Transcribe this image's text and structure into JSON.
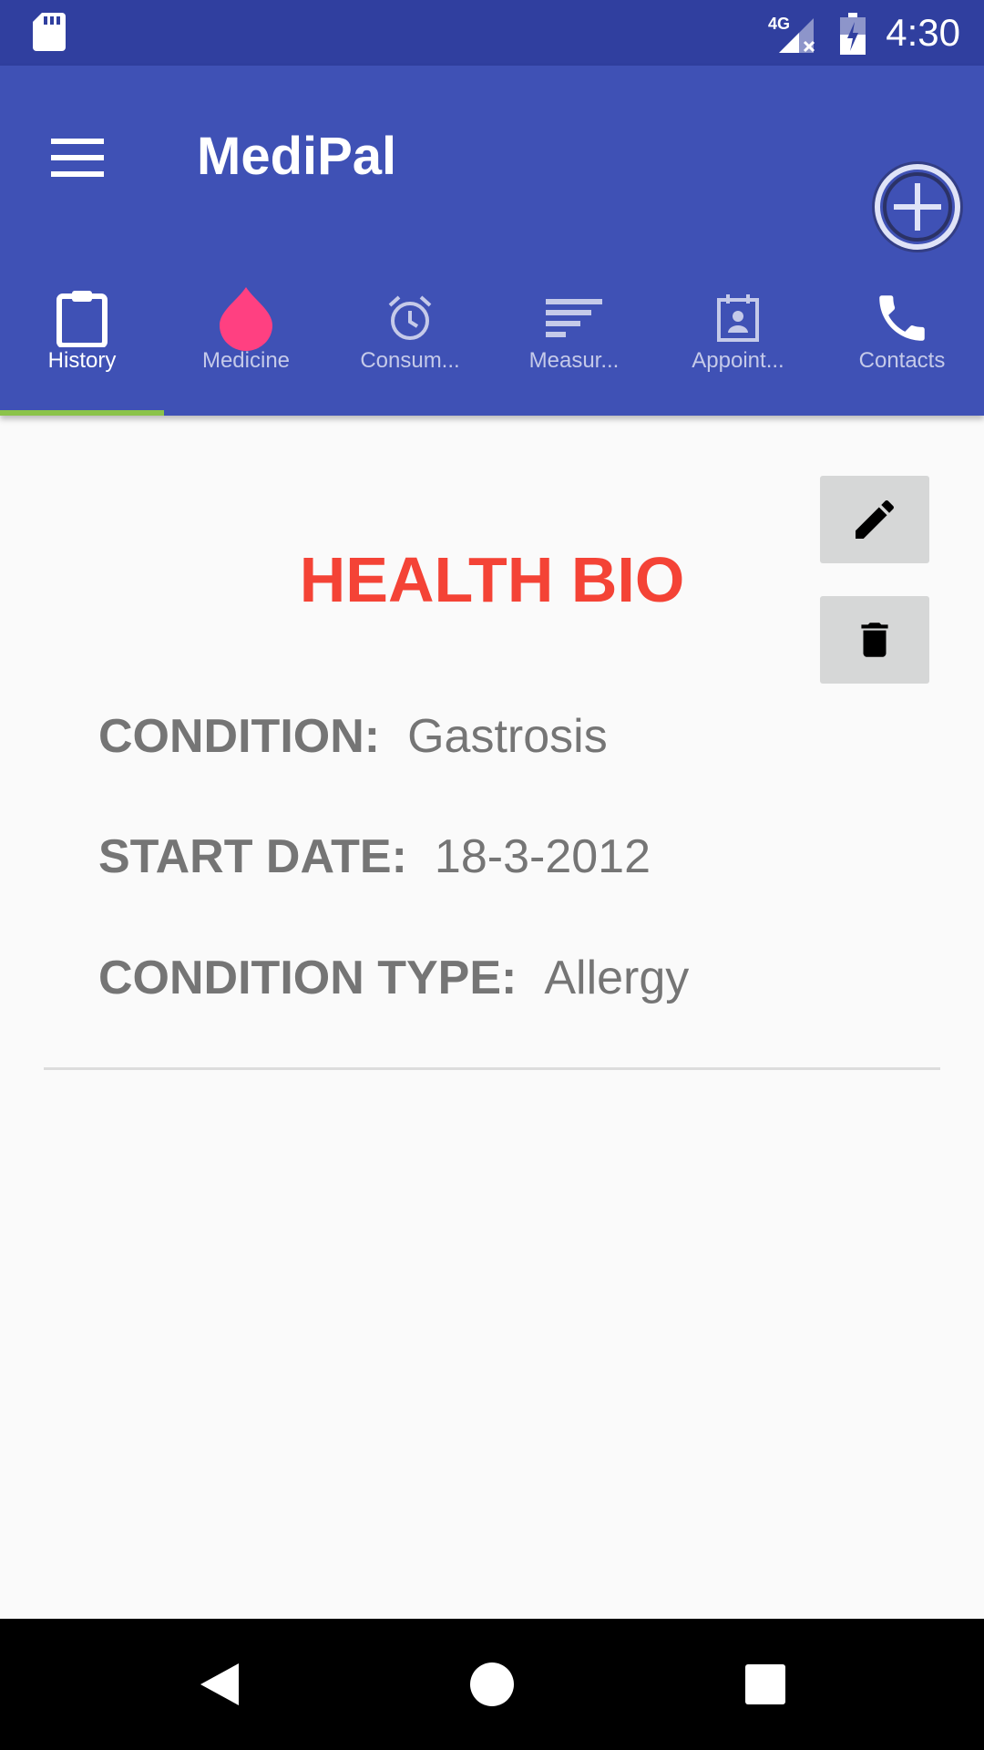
{
  "status_bar": {
    "time": "4:30",
    "network_label": "4G",
    "icons": [
      "sd-card-icon",
      "signal-icon",
      "battery-icon"
    ]
  },
  "app_bar": {
    "title": "MediPal",
    "menu_icon": "hamburger-menu-icon",
    "add_icon": "add-circle-icon",
    "color": "#3f51b5"
  },
  "tabs": [
    {
      "label": "History",
      "icon": "clipboard-icon",
      "active": true
    },
    {
      "label": "Medicine",
      "icon": "drop-icon",
      "active": false
    },
    {
      "label": "Consum...",
      "icon": "alarm-clock-icon",
      "active": false
    },
    {
      "label": "Measur...",
      "icon": "sort-lines-icon",
      "active": false
    },
    {
      "label": "Appoint...",
      "icon": "calendar-contact-icon",
      "active": false
    },
    {
      "label": "Contacts",
      "icon": "phone-icon",
      "active": false
    }
  ],
  "health_bio": {
    "title": "HEALTH BIO",
    "title_color": "#f44336",
    "condition_label": "CONDITION:",
    "condition_value": "Gastrosis",
    "start_date_label": "START DATE:",
    "start_date_value": "18-3-2012",
    "condition_type_label": "CONDITION TYPE:",
    "condition_type_value": "Allergy",
    "edit_icon": "pencil-icon",
    "delete_icon": "trash-icon"
  },
  "nav_bar": {
    "icons": [
      "back-icon",
      "home-icon",
      "recents-icon"
    ]
  }
}
